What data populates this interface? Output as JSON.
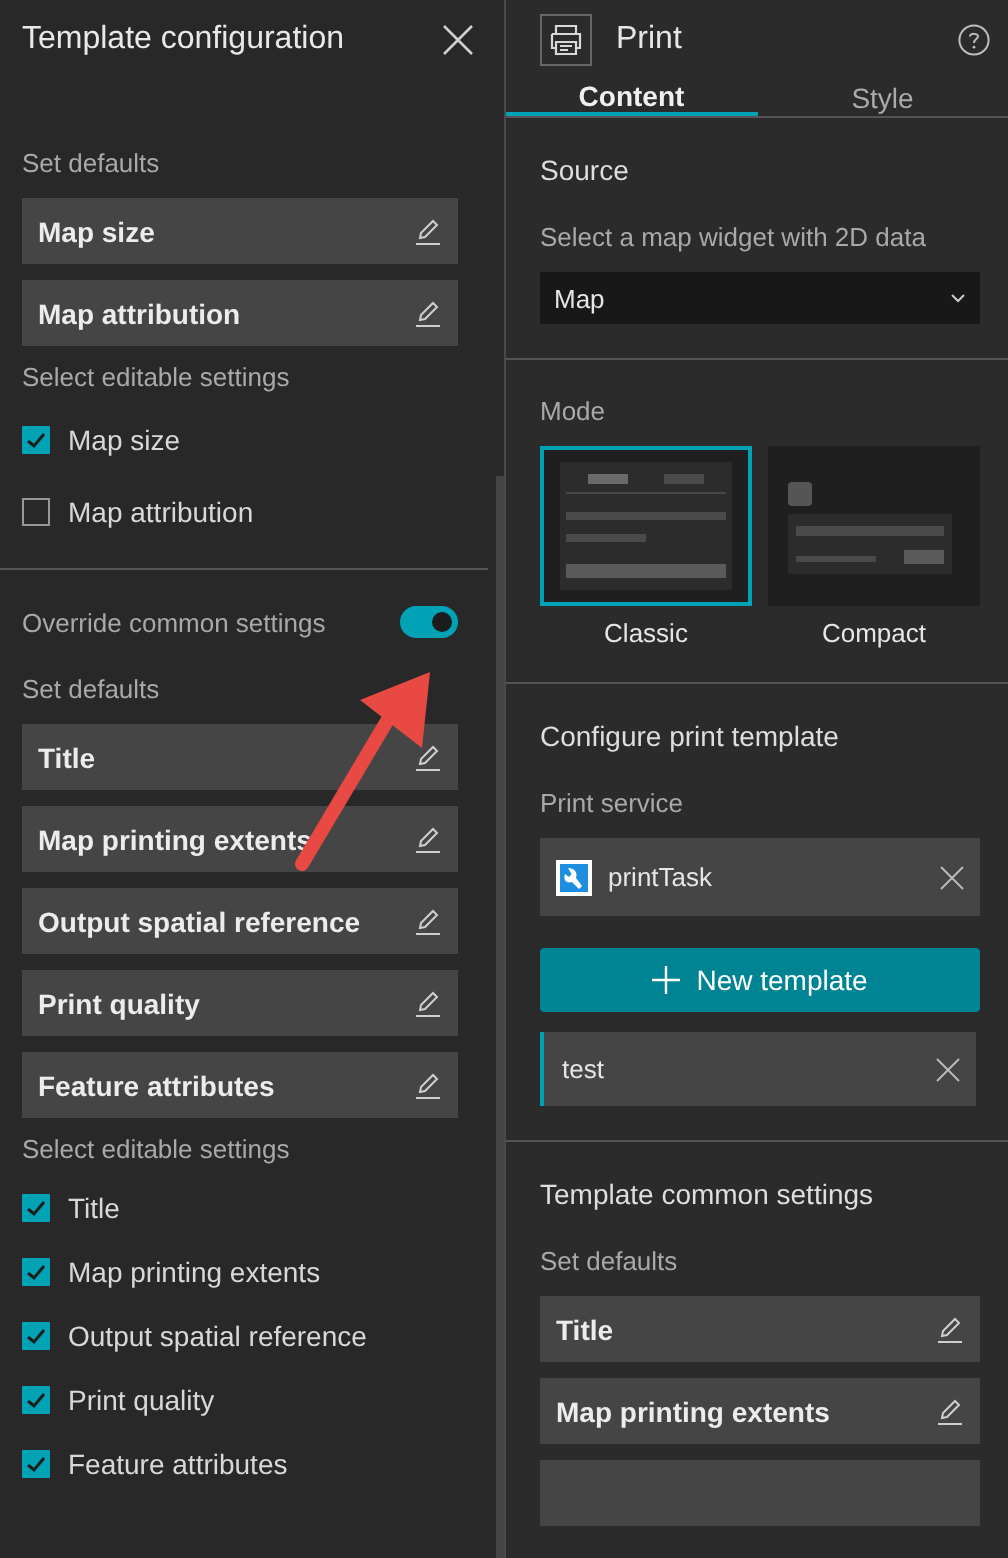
{
  "left_panel": {
    "title": "Template configuration",
    "sections": [
      {
        "defaults_label": "Set defaults",
        "defaults": [
          "Map size",
          "Map attribution"
        ],
        "editable_label": "Select editable settings",
        "editable": [
          {
            "label": "Map size",
            "checked": true
          },
          {
            "label": "Map attribution",
            "checked": false
          }
        ]
      },
      {
        "override": {
          "label": "Override common settings",
          "on": true
        },
        "defaults_label": "Set defaults",
        "defaults": [
          "Title",
          "Map printing extents",
          "Output spatial reference",
          "Print quality",
          "Feature attributes"
        ],
        "editable_label": "Select editable settings",
        "editable": [
          {
            "label": "Title",
            "checked": true
          },
          {
            "label": "Map printing extents",
            "checked": true
          },
          {
            "label": "Output spatial reference",
            "checked": true
          },
          {
            "label": "Print quality",
            "checked": true
          },
          {
            "label": "Feature attributes",
            "checked": true
          }
        ]
      }
    ]
  },
  "right_panel": {
    "title": "Print",
    "tabs": [
      {
        "label": "Content",
        "selected": true
      },
      {
        "label": "Style",
        "selected": false
      }
    ],
    "source": {
      "heading": "Source",
      "label": "Select a map widget with 2D data",
      "dropdown": "Map"
    },
    "mode": {
      "heading": "Mode",
      "options": [
        {
          "kind": "classic",
          "label": "Classic",
          "selected": true
        },
        {
          "kind": "compact",
          "label": "Compact",
          "selected": false
        }
      ]
    },
    "print_template": {
      "heading": "Configure print template",
      "service_label": "Print service",
      "service": "printTask",
      "button": "New template",
      "templates": [
        {
          "name": "test",
          "selected": true
        }
      ]
    },
    "common": {
      "heading": "Template common settings",
      "defaults_label": "Set defaults",
      "defaults": [
        "Title",
        "Map printing extents"
      ]
    }
  }
}
